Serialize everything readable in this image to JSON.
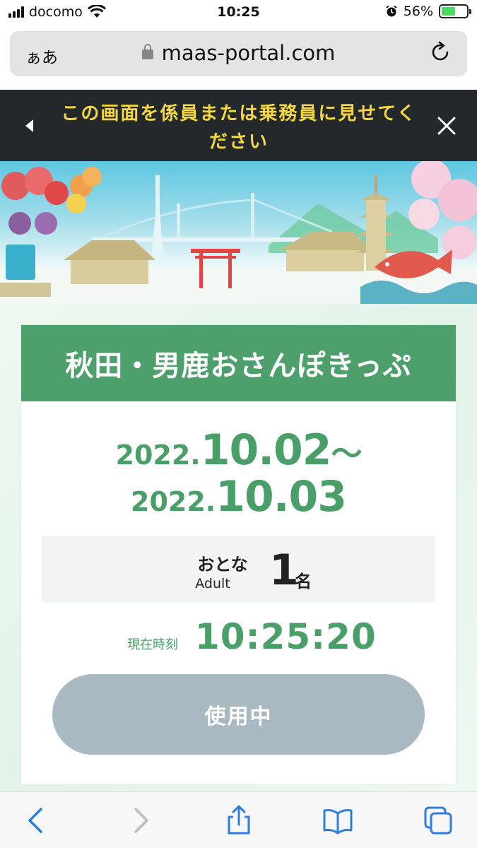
{
  "status_bar": {
    "carrier": "docomo",
    "time": "10:25",
    "battery": "56%",
    "battery_level": 0.56
  },
  "url_bar": {
    "aa_label": "ぁあ",
    "domain": "maas-portal.com"
  },
  "notice": {
    "text": "この画面を係員または乗務員に見せてください"
  },
  "ticket": {
    "title": "秋田・男鹿おさんぽきっぷ",
    "start_year": "2022.",
    "start_md": "10.02",
    "range_sep": "〜",
    "end_year": "2022.",
    "end_md": "10.03",
    "passenger_type_jp": "おとな",
    "passenger_type_en": "Adult",
    "passenger_count": "1",
    "passenger_unit": "名",
    "current_time_label": "現在時刻",
    "current_time": "10:25:20",
    "status_button": "使用中"
  },
  "colors": {
    "accent_green": "#4da06c",
    "notice_bg": "#23282a",
    "notice_text": "#f4d742",
    "button_disabled": "#a8b9c2"
  },
  "toolbar": {
    "icons": [
      "back-icon",
      "forward-icon",
      "share-icon",
      "bookmarks-icon",
      "tabs-icon"
    ]
  }
}
